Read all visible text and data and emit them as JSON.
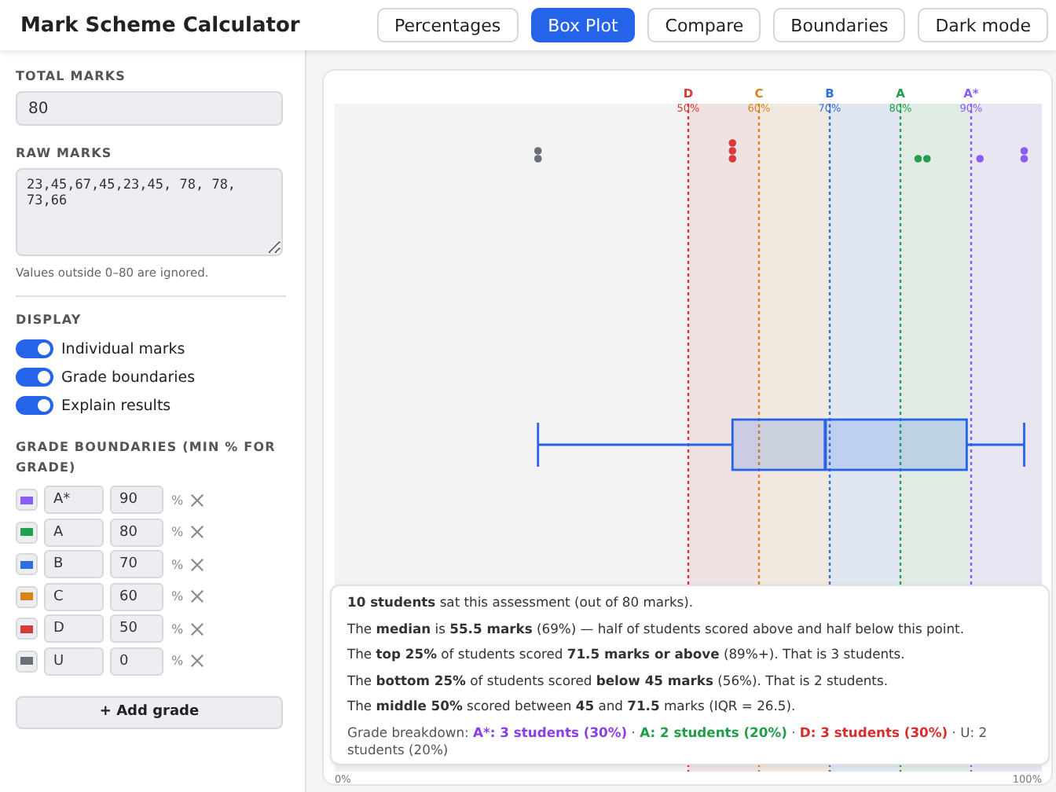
{
  "header": {
    "title": "Mark Scheme Calculator"
  },
  "tabs": [
    {
      "label": "Percentages",
      "selected": false
    },
    {
      "label": "Box Plot",
      "selected": true
    },
    {
      "label": "Compare",
      "selected": false
    },
    {
      "label": "Boundaries",
      "selected": false
    }
  ],
  "dark_mode_button": {
    "label": "Dark mode"
  },
  "sidebar": {
    "total_marks": {
      "label": "TOTAL MARKS",
      "value": "80"
    },
    "raw_marks": {
      "label": "RAW MARKS",
      "value": "23,45,67,45,23,45, 78, 78, 73,66",
      "hint": "Values outside 0–80 are ignored."
    },
    "display": {
      "label": "DISPLAY",
      "toggles": [
        {
          "label": "Individual marks",
          "on": true
        },
        {
          "label": "Grade boundaries",
          "on": true
        },
        {
          "label": "Explain results",
          "on": true
        }
      ]
    },
    "grade_boundaries": {
      "label": "GRADE BOUNDARIES (MIN % FOR GRADE)",
      "grades": [
        {
          "name": "A*",
          "min": "90",
          "unit": "%",
          "color": "#8b5cf6"
        },
        {
          "name": "A",
          "min": "80",
          "unit": "%",
          "color": "#22a04b"
        },
        {
          "name": "B",
          "min": "70",
          "unit": "%",
          "color": "#2f6fdc"
        },
        {
          "name": "C",
          "min": "60",
          "unit": "%",
          "color": "#d9821a"
        },
        {
          "name": "D",
          "min": "50",
          "unit": "%",
          "color": "#d63a3a"
        },
        {
          "name": "U",
          "min": "0",
          "unit": "%",
          "color": "#6b6f76"
        }
      ],
      "add_button": "+ Add grade"
    }
  },
  "chart": {
    "grade_lines": [
      {
        "grade": "D",
        "percent": "50%",
        "color": "#d63a3a"
      },
      {
        "grade": "C",
        "percent": "60%",
        "color": "#d9821a"
      },
      {
        "grade": "B",
        "percent": "70%",
        "color": "#2f6fdc"
      },
      {
        "grade": "A",
        "percent": "80%",
        "color": "#22a04b"
      },
      {
        "grade": "A*",
        "percent": "90%",
        "color": "#8b5cf6"
      }
    ],
    "axis_labels": [
      "0%",
      "100%"
    ]
  },
  "explanation": {
    "lines": [
      "**10 students** sat this assessment (out of 80 marks).",
      "The **median** is **55.5 marks** (69%) — half of students scored above and half below this point.",
      "The **top 25%** of students scored **71.5 marks or above** (89%+). That is 3 students.",
      "The **bottom 25%** of students scored **below 45 marks** (56%). That is 2 students.",
      "The **middle 50%** scored between **45** and **71.5** marks (IQR = 26.5)."
    ],
    "breakdown": {
      "label": "Grade breakdown:",
      "separator": "·",
      "items": [
        {
          "text": "A*: 3 students (30%)",
          "color": "#8b3ee8",
          "highlighted": true
        },
        {
          "text": "A: 2 students (20%)",
          "color": "#1f9d48",
          "highlighted": true
        },
        {
          "text": "D: 3 students (30%)",
          "color": "#d92d2d",
          "highlighted": true
        },
        {
          "text": "U: 2 students (20%)",
          "color": "#555555",
          "highlighted": false
        }
      ]
    }
  }
}
